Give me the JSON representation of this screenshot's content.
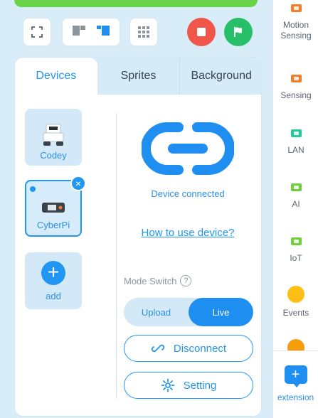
{
  "toolbar": {
    "buttons": [
      "fullscreen-icon",
      "layout-split-icon",
      "layout-stage-icon",
      "grid-icon",
      "stop-icon",
      "green-flag-icon"
    ],
    "colors": {
      "stop": "#f0564a",
      "go": "#27c068"
    }
  },
  "tabs": [
    {
      "label": "Devices",
      "active": true
    },
    {
      "label": "Sprites",
      "active": false
    },
    {
      "label": "Background",
      "active": false
    }
  ],
  "devices": [
    {
      "label": "Codey",
      "selected": false
    },
    {
      "label": "CyberPi",
      "selected": true
    }
  ],
  "add_label": "add",
  "status": {
    "connected_text": "Device connected",
    "howto_link": "How to use device?"
  },
  "mode": {
    "label": "Mode Switch",
    "help": "?",
    "options": [
      {
        "label": "Upload",
        "active": false
      },
      {
        "label": "Live",
        "active": true
      }
    ]
  },
  "actions": {
    "disconnect": "Disconnect",
    "setting": "Setting"
  },
  "categories": [
    {
      "label_line1": "Motion",
      "label_line2": "Sensing",
      "color": "#f27e2b",
      "shape": "chip"
    },
    {
      "label_line1": "Sensing",
      "label_line2": "",
      "color": "#f27e2b",
      "shape": "chip"
    },
    {
      "label_line1": "LAN",
      "label_line2": "",
      "color": "#26c79a",
      "shape": "chip"
    },
    {
      "label_line1": "AI",
      "label_line2": "",
      "color": "#6fcf3c",
      "shape": "chip"
    },
    {
      "label_line1": "IoT",
      "label_line2": "",
      "color": "#6fcf3c",
      "shape": "chip"
    },
    {
      "label_line1": "Events",
      "label_line2": "",
      "color": "#ffbf14",
      "shape": "dot"
    },
    {
      "label_line1": "",
      "label_line2": "",
      "color": "#f59d0b",
      "shape": "dot"
    }
  ],
  "extension": {
    "label": "extension",
    "icon": "extension-add-icon"
  }
}
